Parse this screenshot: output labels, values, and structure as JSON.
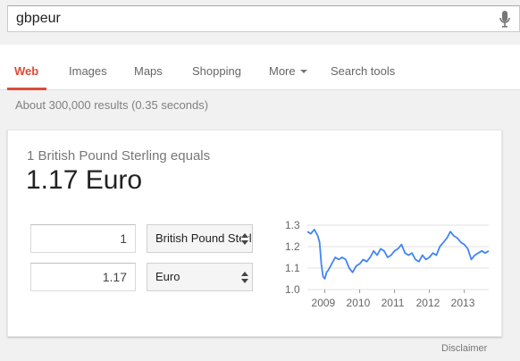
{
  "search": {
    "query": "gbpeur"
  },
  "tabs": [
    {
      "label": "Web"
    },
    {
      "label": "Images"
    },
    {
      "label": "Maps"
    },
    {
      "label": "Shopping"
    },
    {
      "label": "More"
    },
    {
      "label": "Search tools"
    }
  ],
  "stats": "About 300,000 results (0.35 seconds)",
  "converter": {
    "equals_text": "1 British Pound Sterling equals",
    "result_text": "1.17 Euro",
    "from_amount": "1",
    "from_currency": "British Pound Sterling",
    "to_amount": "1.17",
    "to_currency": "Euro"
  },
  "chart_data": {
    "type": "line",
    "title": "",
    "xlabel": "",
    "ylabel": "",
    "x_ticks": [
      "2009",
      "2010",
      "2011",
      "2012",
      "2013"
    ],
    "y_ticks": [
      "1.3",
      "1.2",
      "1.1",
      "1.0"
    ],
    "ylim": [
      1.0,
      1.3
    ],
    "xlim": [
      2008.5,
      2013.7
    ],
    "grid": true,
    "color": "#4285f4",
    "series": [
      {
        "x": [
          2008.5,
          2008.6,
          2008.7,
          2008.8,
          2008.85,
          2008.9,
          2008.95,
          2009.0,
          2009.05,
          2009.1,
          2009.2,
          2009.3,
          2009.4,
          2009.5,
          2009.6,
          2009.7,
          2009.8,
          2009.9,
          2010.0,
          2010.1,
          2010.2,
          2010.3,
          2010.4,
          2010.5,
          2010.6,
          2010.7,
          2010.8,
          2010.9,
          2011.0,
          2011.1,
          2011.2,
          2011.3,
          2011.4,
          2011.5,
          2011.6,
          2011.7,
          2011.8,
          2011.9,
          2012.0,
          2012.1,
          2012.2,
          2012.3,
          2012.4,
          2012.5,
          2012.6,
          2012.7,
          2012.8,
          2012.9,
          2013.0,
          2013.1,
          2013.2,
          2013.3,
          2013.4,
          2013.5,
          2013.6,
          2013.7
        ],
        "y": [
          1.27,
          1.26,
          1.28,
          1.25,
          1.22,
          1.12,
          1.06,
          1.05,
          1.08,
          1.09,
          1.12,
          1.15,
          1.14,
          1.15,
          1.14,
          1.1,
          1.08,
          1.11,
          1.12,
          1.14,
          1.13,
          1.15,
          1.18,
          1.16,
          1.19,
          1.18,
          1.15,
          1.16,
          1.18,
          1.19,
          1.21,
          1.17,
          1.16,
          1.17,
          1.14,
          1.13,
          1.16,
          1.14,
          1.15,
          1.17,
          1.16,
          1.2,
          1.22,
          1.24,
          1.27,
          1.25,
          1.24,
          1.22,
          1.21,
          1.19,
          1.14,
          1.16,
          1.17,
          1.18,
          1.17,
          1.18
        ]
      }
    ]
  },
  "disclaimer": "Disclaimer",
  "colors": {
    "accent": "#dd4b39",
    "chart_line": "#4285f4"
  },
  "icons": {
    "mic": "microphone-icon"
  }
}
